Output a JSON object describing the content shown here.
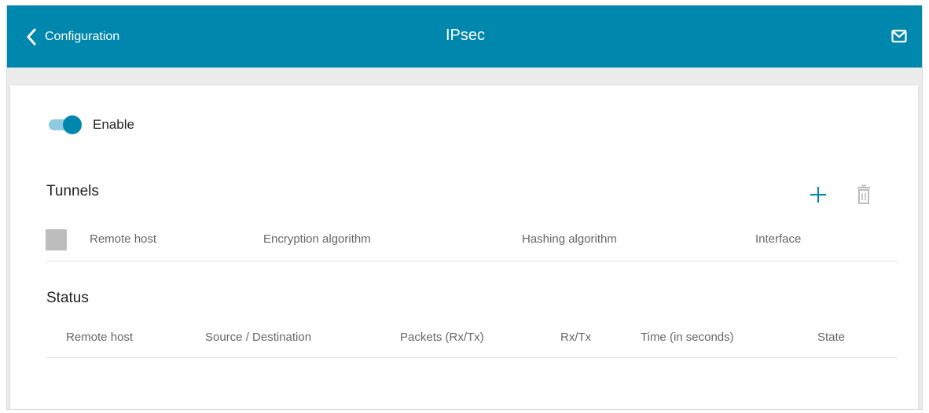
{
  "header": {
    "back_label": "Configuration",
    "title": "IPsec",
    "accent_color": "#0087ad"
  },
  "enable": {
    "label": "Enable",
    "checked": true
  },
  "tunnels": {
    "title": "Tunnels",
    "columns": [
      "Remote host",
      "Encryption algorithm",
      "Hashing algorithm",
      "Interface"
    ],
    "rows": []
  },
  "status": {
    "title": "Status",
    "columns": [
      "Remote host",
      "Source / Destination",
      "Packets (Rx/Tx)",
      "Rx/Tx",
      "Time (in seconds)",
      "State"
    ],
    "rows": []
  },
  "icons": {
    "back": "chevron-left-icon",
    "mail": "mail-icon",
    "add": "plus-icon",
    "delete": "trash-icon"
  }
}
